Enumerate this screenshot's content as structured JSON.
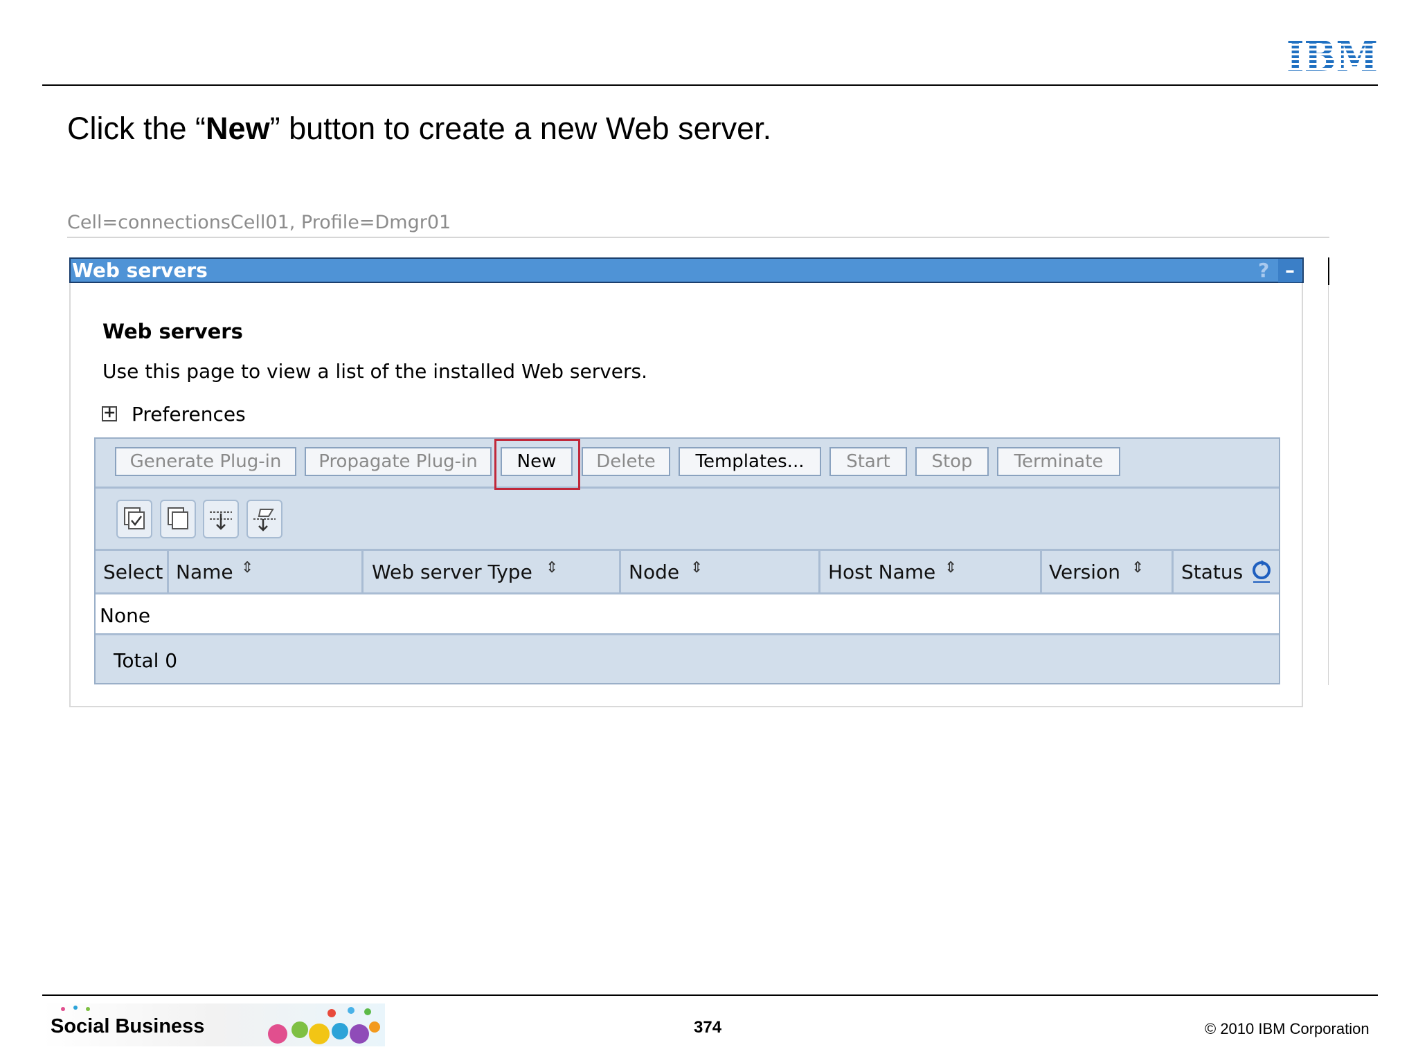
{
  "slide": {
    "logo": "IBM",
    "instruction": {
      "prefix": "Click the “",
      "emphasis": "New",
      "suffix": "” button to create a new Web server."
    },
    "footer": {
      "brand": "Social Business",
      "page_number": "374",
      "copyright": "© 2010 IBM Corporation"
    }
  },
  "console": {
    "breadcrumb": "Cell=connectionsCell01, Profile=Dmgr01",
    "panel_title": "Web servers",
    "help_label": "?",
    "minimize_label": "–",
    "section_heading": "Web servers",
    "description": "Use this page to view a list of the installed Web servers.",
    "preferences_label": "Preferences",
    "buttons": {
      "generate_plugin": "Generate Plug-in",
      "propagate_plugin": "Propagate Plug-in",
      "new": "New",
      "delete": "Delete",
      "templates": "Templates...",
      "start": "Start",
      "stop": "Stop",
      "terminate": "Terminate"
    },
    "icons": [
      "select-all-icon",
      "deselect-all-icon",
      "show-filter-icon",
      "clear-filter-icon"
    ],
    "columns": {
      "select": "Select",
      "name": "Name",
      "type": "Web server Type",
      "node": "Node",
      "host": "Host Name",
      "version": "Version",
      "status": "Status"
    },
    "empty_row": "None",
    "total": "Total 0"
  },
  "colors": {
    "titlebar": "#4f93d6",
    "table_bg": "#d2deeb",
    "highlight": "#c0283a",
    "ibm_blue": "#1f70c1"
  }
}
